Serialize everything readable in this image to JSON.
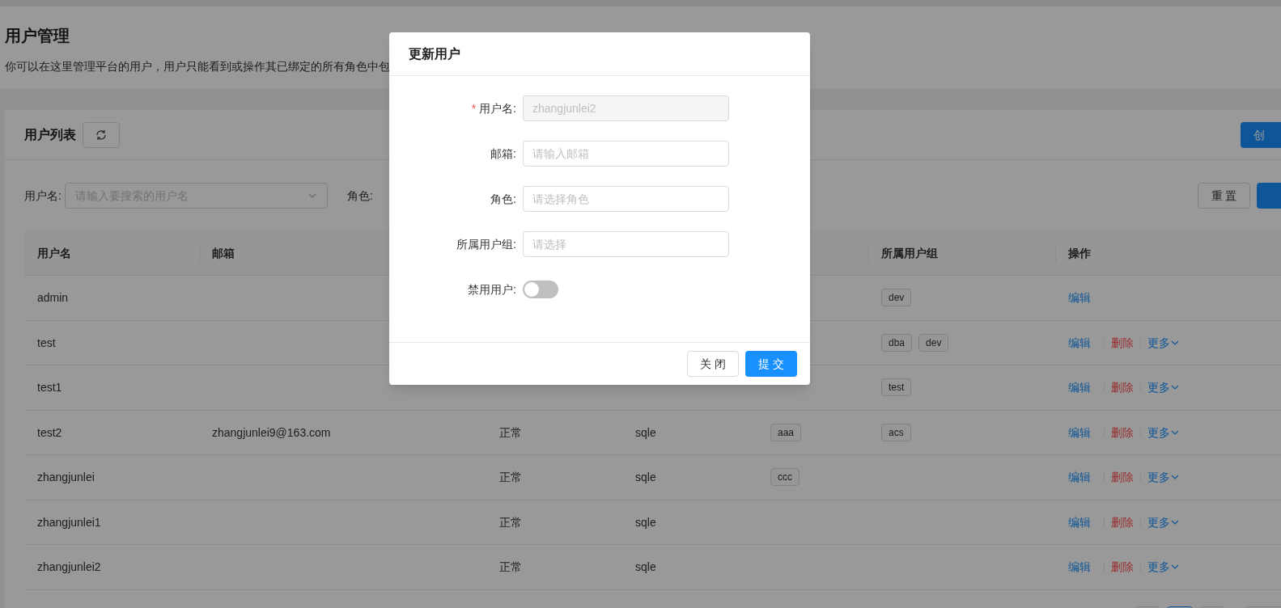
{
  "page": {
    "title": "用户管理",
    "description": "你可以在这里管理平台的用户，用户只能看到或操作其已绑定的所有角色中包"
  },
  "card": {
    "title": "用户列表",
    "create_button": "创"
  },
  "filters": {
    "username_label": "用户名:",
    "username_placeholder": "请输入要搜索的用户名",
    "role_label": "角色:",
    "reset_button": "重 置"
  },
  "table": {
    "columns": [
      {
        "label": "用户名"
      },
      {
        "label": "邮箱"
      },
      {},
      {},
      {},
      {
        "label": "所属用户组"
      },
      {
        "label": "操作"
      }
    ],
    "rows": [
      {
        "username": "admin",
        "groups": [
          "dev"
        ],
        "actions": [
          {
            "kind": "edit",
            "label": "编辑"
          }
        ]
      },
      {
        "username": "test",
        "groups": [
          "dba",
          "dev"
        ],
        "actions": [
          {
            "kind": "edit",
            "label": "编辑"
          },
          {
            "kind": "delete",
            "label": "删除"
          },
          {
            "kind": "more",
            "label": "更多"
          }
        ]
      },
      {
        "username": "test1",
        "groups": [
          "test"
        ],
        "actions": [
          {
            "kind": "edit",
            "label": "编辑"
          },
          {
            "kind": "delete",
            "label": "删除"
          },
          {
            "kind": "more",
            "label": "更多"
          }
        ]
      },
      {
        "username": "test2",
        "email": "zhangjunlei9@163.com",
        "status": "正常",
        "platform": "sqle",
        "roles": [
          "aaa"
        ],
        "groups": [
          "acs"
        ],
        "actions": [
          {
            "kind": "edit",
            "label": "编辑"
          },
          {
            "kind": "delete",
            "label": "删除"
          },
          {
            "kind": "more",
            "label": "更多"
          }
        ]
      },
      {
        "username": "zhangjunlei",
        "status": "正常",
        "platform": "sqle",
        "roles": [
          "ccc"
        ],
        "actions": [
          {
            "kind": "edit",
            "label": "编辑"
          },
          {
            "kind": "delete",
            "label": "删除"
          },
          {
            "kind": "more",
            "label": "更多"
          }
        ]
      },
      {
        "username": "zhangjunlei1",
        "status": "正常",
        "platform": "sqle",
        "actions": [
          {
            "kind": "edit",
            "label": "编辑"
          },
          {
            "kind": "delete",
            "label": "删除"
          },
          {
            "kind": "more",
            "label": "更多"
          }
        ]
      },
      {
        "username": "zhangjunlei2",
        "status": "正常",
        "platform": "sqle",
        "actions": [
          {
            "kind": "edit",
            "label": "编辑"
          },
          {
            "kind": "delete",
            "label": "删除"
          },
          {
            "kind": "more",
            "label": "更多"
          }
        ]
      }
    ]
  },
  "pagination": [
    {
      "selected": false
    },
    {
      "selected": true
    },
    {
      "selected": false
    }
  ],
  "modal": {
    "title": "更新用户",
    "fields": [
      {
        "kind": "input",
        "required_mark": "*",
        "label": "用户名:",
        "disabled": true,
        "value": "zhangjunlei2"
      },
      {
        "kind": "input",
        "label": "邮箱:",
        "placeholder": "请输入邮箱"
      },
      {
        "kind": "input",
        "label": "角色:",
        "placeholder": "请选择角色"
      },
      {
        "kind": "input",
        "label": "所属用户组:",
        "placeholder": "请选择"
      },
      {
        "kind": "switch",
        "label": "禁用用户:",
        "on": false
      }
    ],
    "buttons": [
      {
        "kind": "default",
        "label": "关 闭"
      },
      {
        "kind": "primary",
        "label": "提 交"
      }
    ]
  }
}
